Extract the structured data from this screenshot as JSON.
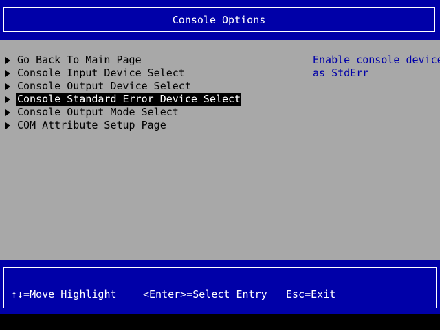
{
  "header": {
    "title": "Console Options"
  },
  "menu": {
    "items": [
      {
        "label": "Go Back To Main Page"
      },
      {
        "label": "Console Input Device Select"
      },
      {
        "label": "Console Output Device Select"
      },
      {
        "label": "Console Standard Error Device Select"
      },
      {
        "label": "Console Output Mode Select"
      },
      {
        "label": "COM Attribute Setup Page"
      }
    ],
    "selected_index": 3
  },
  "help": {
    "lines": [
      "Enable console device",
      "as StdErr"
    ]
  },
  "footer": {
    "move": "↑↓=Move Highlight",
    "select": "<Enter>=Select Entry",
    "exit": "Esc=Exit"
  },
  "colors": {
    "header_bg": "#0000a8",
    "body_bg": "#a8a8a8",
    "help_text": "#0000a8",
    "selected_bg": "#000000",
    "selected_text": "#ffffff"
  },
  "icons": {
    "menu_item_marker": "triangle-right-icon"
  }
}
